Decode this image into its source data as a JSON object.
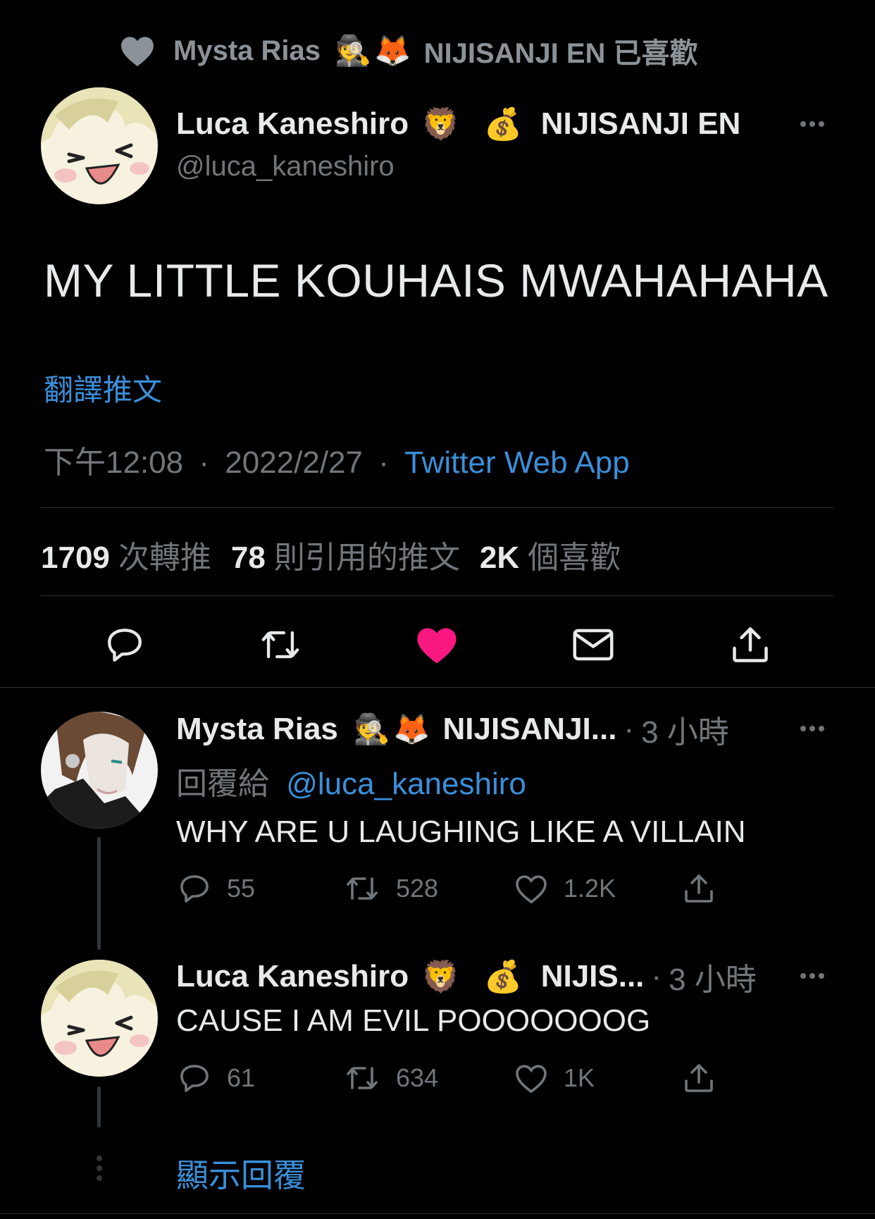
{
  "liked_by": {
    "icon": "heart-icon",
    "name": "Mysta Rias",
    "emoji1": "🕵️",
    "emoji2": "🦊",
    "suffix": "NIJISANJI EN 已喜歡"
  },
  "tweet": {
    "author_name": "Luca Kaneshiro",
    "emoji1": "🦁",
    "emoji2": "💰",
    "affiliation": "NIJISANJI EN",
    "handle": "@luca_kaneshiro",
    "text": "MY LITTLE KOUHAIS MWAHAHAHA",
    "translate_label": "翻譯推文",
    "time": "下午12:08",
    "sep": "·",
    "date": "2022/2/27",
    "app": "Twitter Web App",
    "stats": {
      "retweets_count": "1709",
      "retweets_label": "次轉推",
      "quotes_count": "78",
      "quotes_label": "則引用的推文",
      "likes_count": "2K",
      "likes_label": "個喜歡"
    },
    "actions": [
      "reply-icon",
      "retweet-icon",
      "heart-filled-icon",
      "mail-icon",
      "share-icon"
    ],
    "liked_color": "#f91880"
  },
  "replies": [
    {
      "name": "Mysta Rias",
      "emoji1": "🕵️",
      "emoji2": "🦊",
      "affiliation": "NIJISANJI...",
      "sep": "·",
      "time": "3 小時",
      "reply_to_label": "回覆給",
      "reply_to_handle": "@luca_kaneshiro",
      "text": "WHY ARE U LAUGHING LIKE A VILLAIN",
      "replies": "55",
      "retweets": "528",
      "likes": "1.2K"
    },
    {
      "name": "Luca Kaneshiro",
      "emoji1": "🦁",
      "emoji2": "💰",
      "affiliation": "NIJIS...",
      "sep": "·",
      "time": "3 小時",
      "text": "CAUSE I AM EVIL POOOOOOOG",
      "replies": "61",
      "retweets": "634",
      "likes": "1K"
    }
  ],
  "show_replies_label": "顯示回覆",
  "colors": {
    "background": "#000000",
    "accent": "#3b8fd9",
    "muted": "#71767b",
    "like": "#f91880"
  }
}
